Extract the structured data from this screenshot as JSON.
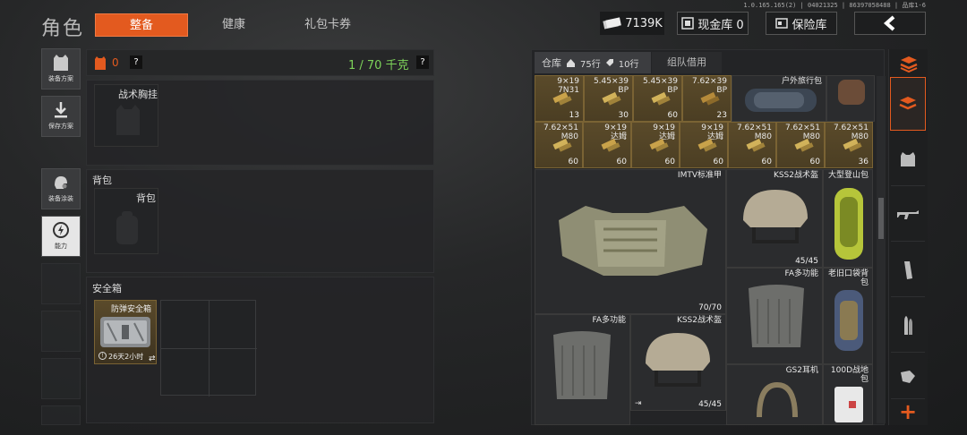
{
  "header": {
    "title": "角色",
    "tabs": [
      {
        "label": "整备",
        "active": true
      },
      {
        "label": "健康",
        "active": false
      },
      {
        "label": "礼包卡券",
        "active": false
      }
    ],
    "currency": "7139K",
    "cash_vault": "现金库 0",
    "insurance": "保险库",
    "version": "1.0.165.165(2) | 04021325 | 86397058488 | 品库1-6",
    "accent_color": "#e35a1f"
  },
  "left_menu": [
    {
      "label": "装备方案",
      "icon": "vest-icon"
    },
    {
      "label": "保存方案",
      "icon": "download-icon"
    },
    {
      "label": "装备涂装",
      "icon": "helmet-paint-icon"
    },
    {
      "label": "能力",
      "icon": "ability-icon"
    }
  ],
  "loadout": {
    "value": "0",
    "help": "?",
    "weight": "1 / 70 千克",
    "weight_help": "?",
    "chest_rig": "战术胸挂",
    "backpack_section": "背包",
    "backpack_slot": "背包",
    "safe_box_section": "安全箱",
    "safe_box_name": "防弹安全箱",
    "safe_box_time": "26天2小时"
  },
  "warehouse": {
    "tab_label": "仓库",
    "rows_home": "75行",
    "rows_tag": "10行",
    "team_borrow": "组队借用",
    "items": {
      "ammo_row1": [
        {
          "name": "9×19\n7N31",
          "qty": "13"
        },
        {
          "name": "5.45×39\nBP",
          "qty": "30"
        },
        {
          "name": "5.45×39\nBP",
          "qty": "60"
        },
        {
          "name": "7.62×39\nBP",
          "qty": "23"
        }
      ],
      "ammo_row2": [
        {
          "name": "7.62×51\nM80",
          "qty": "60"
        },
        {
          "name": "9×19\n达姆",
          "qty": "60"
        },
        {
          "name": "9×19\n达姆",
          "qty": "60"
        },
        {
          "name": "9×19\n达姆",
          "qty": "60"
        },
        {
          "name": "7.62×51\nM80",
          "qty": "60"
        },
        {
          "name": "7.62×51\nM80",
          "qty": "60"
        },
        {
          "name": "7.62×51\nM80",
          "qty": "36"
        }
      ],
      "outdoor_bag": "户外旅行包",
      "imtv": {
        "name": "IMTV标准甲",
        "durability": "70/70"
      },
      "kss2_top": {
        "name": "KSS2战术盔",
        "durability": "45/45"
      },
      "big_backpack": "大型登山包",
      "fa_right": "FA多功能",
      "old_pocket": "老旧口袋背包",
      "fa_left": "FA多功能",
      "kss2_bottom": {
        "name": "KSS2战术盔",
        "durability": "45/45"
      },
      "gs2": "GS2耳机",
      "bag100d": "100D战地包"
    }
  },
  "right_tabs": [
    "sort",
    "all",
    "armor",
    "rifle",
    "magazine",
    "ammo",
    "misc",
    "add"
  ]
}
